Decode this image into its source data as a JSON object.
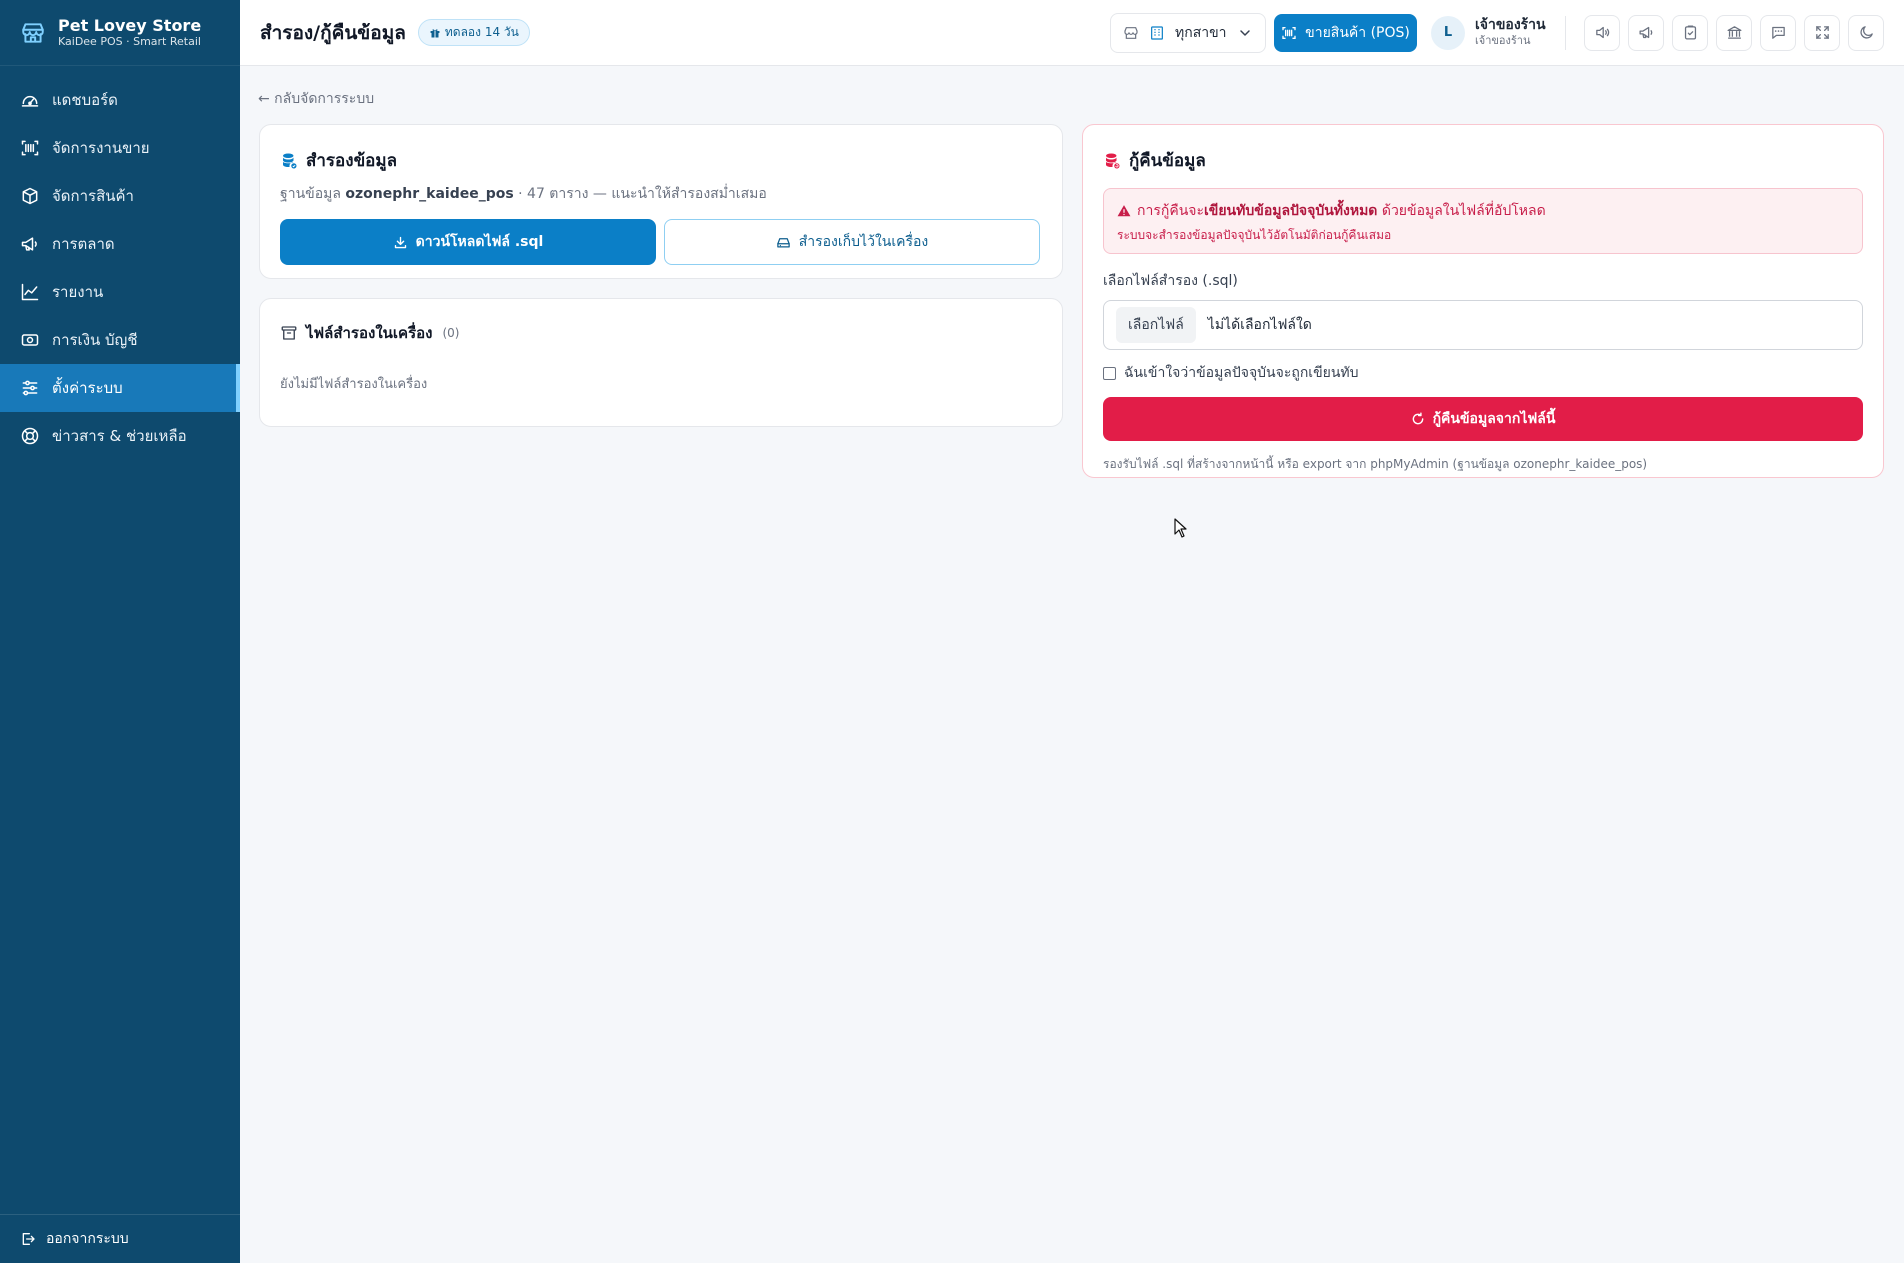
{
  "sidebar": {
    "brand_name": "Pet Lovey Store",
    "brand_sub": "KaiDee POS · Smart Retail",
    "items": [
      {
        "label": "แดชบอร์ด",
        "icon": "dashboard-icon"
      },
      {
        "label": "จัดการงานขาย",
        "icon": "barcode-scan-icon"
      },
      {
        "label": "จัดการสินค้า",
        "icon": "package-icon"
      },
      {
        "label": "การตลาด",
        "icon": "megaphone-icon"
      },
      {
        "label": "รายงาน",
        "icon": "chart-line-icon"
      },
      {
        "label": "การเงิน บัญชี",
        "icon": "money-icon"
      },
      {
        "label": "ตั้งค่าระบบ",
        "icon": "sliders-icon",
        "active": true
      },
      {
        "label": "ข่าวสาร & ช่วยเหลือ",
        "icon": "lifebuoy-icon"
      }
    ],
    "logout_label": "ออกจากระบบ"
  },
  "topbar": {
    "title": "สำรอง/กู้คืนข้อมูล",
    "trial_badge": "ทดลอง 14 วัน",
    "branch_value": "ทุกสาขา",
    "pos_button": "ขายสินค้า (POS)",
    "user_initial": "L",
    "user_name": "เจ้าของร้าน",
    "user_role": "เจ้าของร้าน",
    "icon_buttons": [
      "speaker-icon",
      "megaphone-icon",
      "clipboard-check-icon",
      "bank-icon",
      "chat-icon",
      "fullscreen-icon",
      "moon-icon"
    ]
  },
  "main": {
    "back_link": "← กลับจัดการระบบ",
    "backup": {
      "title": "สำรองข้อมูล",
      "db_prefix": "ฐานข้อมูล",
      "db_name": "ozonephr_kaidee_pos",
      "db_suffix": "· 47 ตาราง — แนะนำให้สำรองสม่ำเสมอ",
      "download_button": "ดาวน์โหลดไฟล์ .sql",
      "local_button": "สำรองเก็บไว้ในเครื่อง"
    },
    "local_files": {
      "title": "ไฟล์สำรองในเครื่อง",
      "count": "(0)",
      "empty_text": "ยังไม่มีไฟล์สำรองในเครื่อง"
    },
    "restore": {
      "title": "กู้คืนข้อมูล",
      "alert_pre": "การกู้คืนจะ",
      "alert_bold": "เขียนทับข้อมูลปัจจุบันทั้งหมด",
      "alert_post": " ด้วยข้อมูลในไฟล์ที่อัปโหลด",
      "alert_line2": "ระบบจะสำรองข้อมูลปัจจุบันไว้อัตโนมัติก่อนกู้คืนเสมอ",
      "file_label": "เลือกไฟล์สำรอง (.sql)",
      "file_button": "เลือกไฟล์",
      "file_value": "ไม่ได้เลือกไฟล์ใด",
      "confirm_label": "ฉันเข้าใจว่าข้อมูลปัจจุบันจะถูกเขียนทับ",
      "restore_button": "กู้คืนข้อมูลจากไฟล์นี้",
      "hint": "รองรับไฟล์ .sql ที่สร้างจากหน้านี้ หรือ export จาก phpMyAdmin (ฐานข้อมูล ozonephr_kaidee_pos)"
    }
  },
  "colors": {
    "sidebar_bg": "#0e4a6e",
    "primary": "#0b7fc7",
    "danger": "#e21d48",
    "page_bg": "#f5f7fa"
  }
}
